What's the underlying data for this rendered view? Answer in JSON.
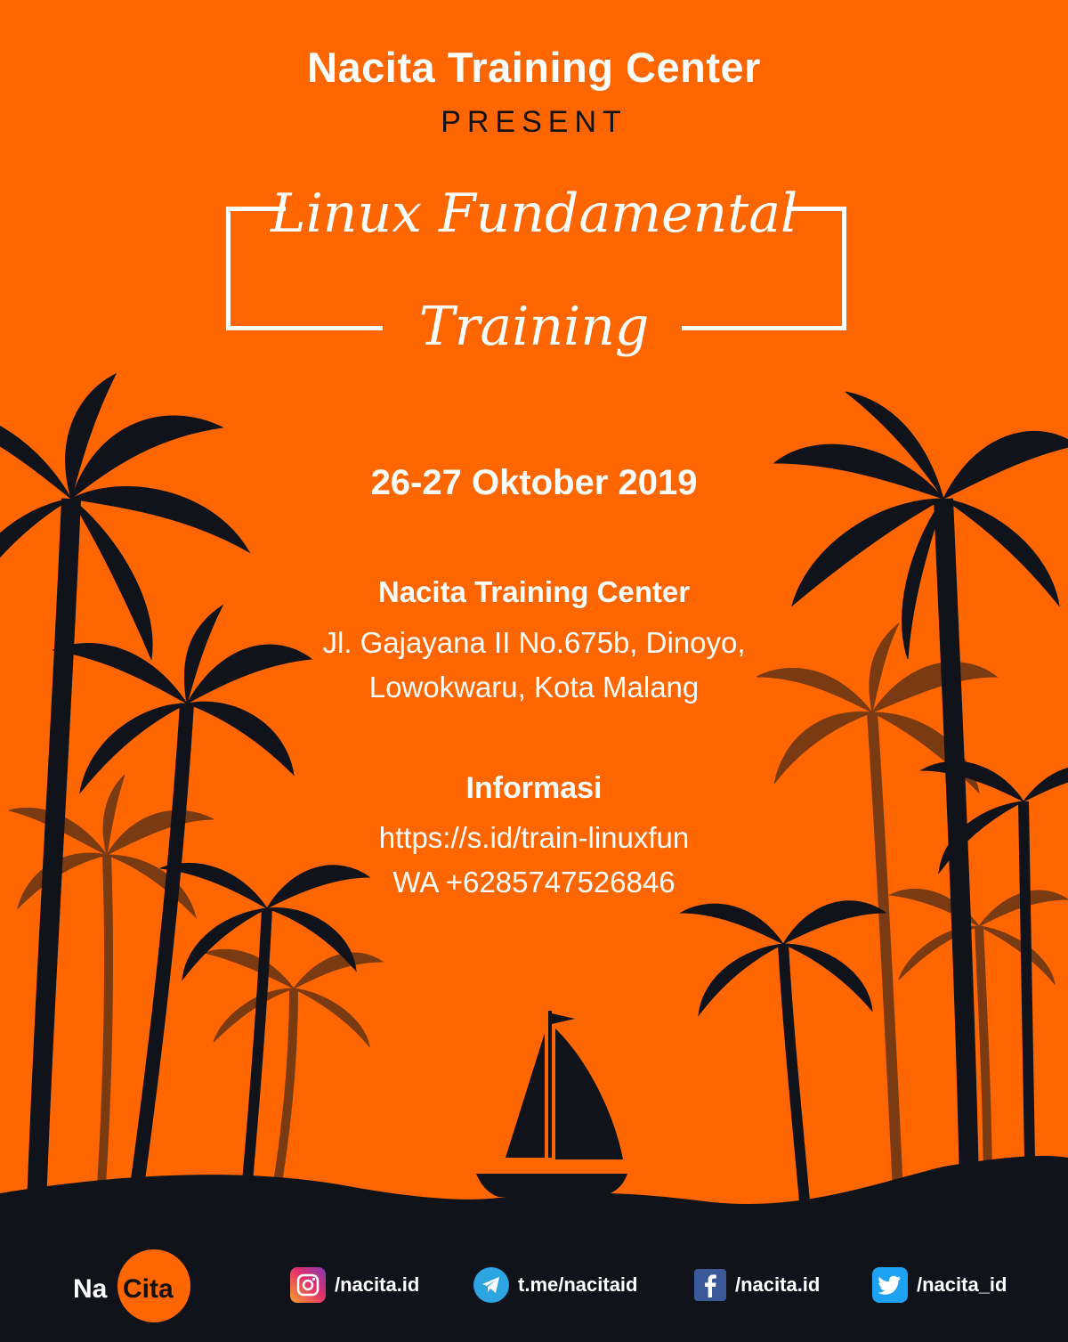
{
  "header": {
    "organizer": "Nacita Training Center",
    "present": "PRESENT"
  },
  "title": {
    "line1": "Linux Fundamental",
    "line2": "Training"
  },
  "event": {
    "date": "26-27 Oktober 2019",
    "venue_name": "Nacita Training Center",
    "address_line1": "Jl. Gajayana II No.675b, Dinoyo,",
    "address_line2": "Lowokwaru, Kota Malang"
  },
  "info": {
    "heading": "Informasi",
    "link": "https://s.id/train-linuxfun",
    "whatsapp": "WA +6285747526846"
  },
  "footer": {
    "logo_na": "Na",
    "logo_cita": "Cita",
    "social": [
      {
        "icon": "instagram-icon",
        "text": "/nacita.id"
      },
      {
        "icon": "telegram-icon",
        "text": "t.me/nacitaid"
      },
      {
        "icon": "facebook-icon",
        "text": "/nacita.id"
      },
      {
        "icon": "twitter-icon",
        "text": "/nacita_id"
      }
    ]
  },
  "colors": {
    "background": "#ff6600",
    "silhouette": "#11131a",
    "faded_palm": "#7a3a12",
    "text": "#ffffff"
  }
}
